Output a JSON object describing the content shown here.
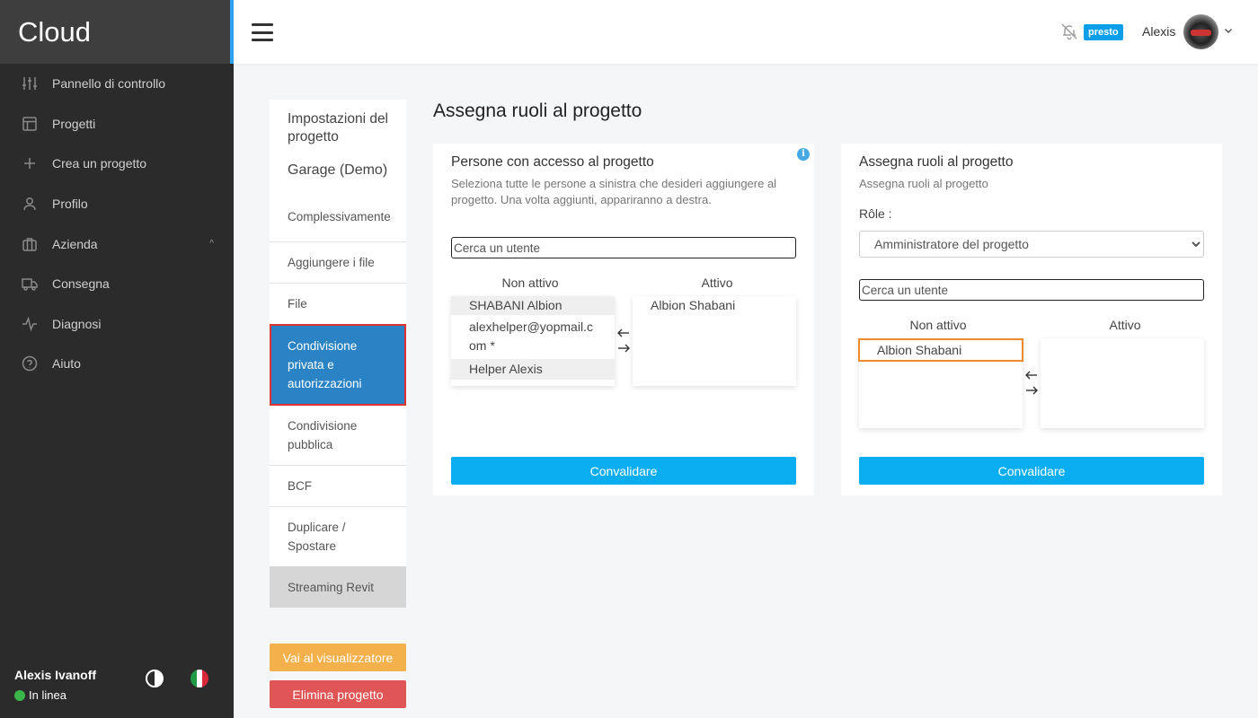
{
  "sidebar": {
    "logo": "Cloud",
    "items": [
      {
        "label": "Pannello di controllo",
        "icon": "sliders-icon"
      },
      {
        "label": "Progetti",
        "icon": "layout-icon"
      },
      {
        "label": "Crea un progetto",
        "icon": "plus-icon"
      },
      {
        "label": "Profilo",
        "icon": "user-icon"
      },
      {
        "label": "Azienda",
        "icon": "briefcase-icon",
        "chevron": "^"
      },
      {
        "label": "Consegna",
        "icon": "truck-icon"
      },
      {
        "label": "Diagnosi",
        "icon": "activity-icon"
      },
      {
        "label": "Aiuto",
        "icon": "help-circle-icon"
      }
    ],
    "user": {
      "name": "Alexis Ivanoff",
      "status": "In linea"
    }
  },
  "topbar": {
    "badge": "presto",
    "user": "Alexis"
  },
  "settings": {
    "heading": "Impostazioni del progetto",
    "project": "Garage (Demo)",
    "items": [
      "Complessivamente",
      "Aggiungere i file",
      "File",
      "Condivisione privata e autorizzazioni",
      "Condivisione pubblica",
      "BCF",
      "Duplicare / Spostare",
      "Streaming Revit"
    ],
    "viewer_button": "Vai al visualizzatore",
    "delete_button": "Elimina progetto"
  },
  "main": {
    "title": "Assegna ruoli al progetto",
    "access_card": {
      "title": "Persone con accesso al progetto",
      "subtitle": "Seleziona tutte le persone a sinistra che desideri aggiungere al progetto. Una volta aggiunti, appariranno a destra.",
      "search_placeholder": "Cerca un utente",
      "inactive_label": "Non attivo",
      "active_label": "Attivo",
      "inactive_users": [
        "SHABANI Albion",
        "alexhelper@yopmail.com *",
        "Helper Alexis"
      ],
      "active_users": [
        "Albion Shabani"
      ],
      "validate": "Convalidare"
    },
    "roles_card": {
      "title": "Assegna ruoli al progetto",
      "subtitle": "Assegna ruoli al progetto",
      "role_label": "Rôle :",
      "role_selected": "Amministratore del progetto",
      "search_placeholder": "Cerca un utente",
      "inactive_label": "Non attivo",
      "active_label": "Attivo",
      "inactive_users": [
        "Albion Shabani"
      ],
      "active_users": [],
      "validate": "Convalidare"
    }
  },
  "colors": {
    "accent": "#0aaef0",
    "active_menu": "#2a83c4",
    "viewer_button": "#f4b04a",
    "delete_button": "#e05656",
    "highlight": "#ef8a2a"
  }
}
